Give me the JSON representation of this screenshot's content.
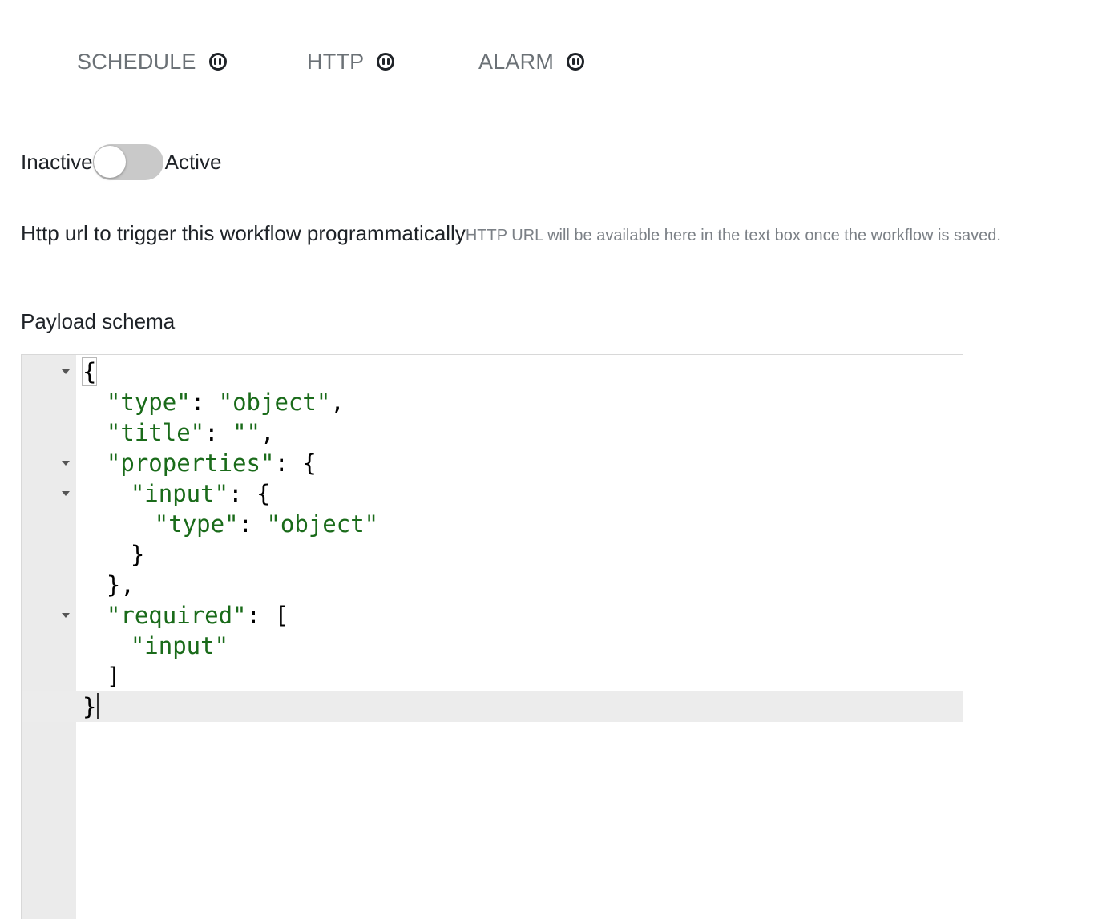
{
  "tabs": [
    {
      "label": "SCHEDULE",
      "icon": "pause-circle-icon"
    },
    {
      "label": "HTTP",
      "icon": "pause-circle-icon"
    },
    {
      "label": "ALARM",
      "icon": "pause-circle-icon"
    }
  ],
  "toggle": {
    "left_label": "Inactive",
    "right_label": "Active",
    "state": "inactive"
  },
  "http_url": {
    "label": "Http url to trigger this workflow programmatically",
    "hint": "HTTP URL will be available here in the text box once the workflow is saved."
  },
  "payload_schema": {
    "label": "Payload schema",
    "lines": [
      "{",
      "  \"type\": \"object\",",
      "  \"title\": \"\",",
      "  \"properties\": {",
      "    \"input\": {",
      "      \"type\": \"object\"",
      "    }",
      "  },",
      "  \"required\": [",
      "    \"input\"",
      "  ]",
      "}"
    ]
  },
  "colors": {
    "string": "#1a6b1a",
    "gutter": "#ebebeb",
    "toggle_off": "#c9c9c9",
    "tab_text": "#6b7176"
  }
}
